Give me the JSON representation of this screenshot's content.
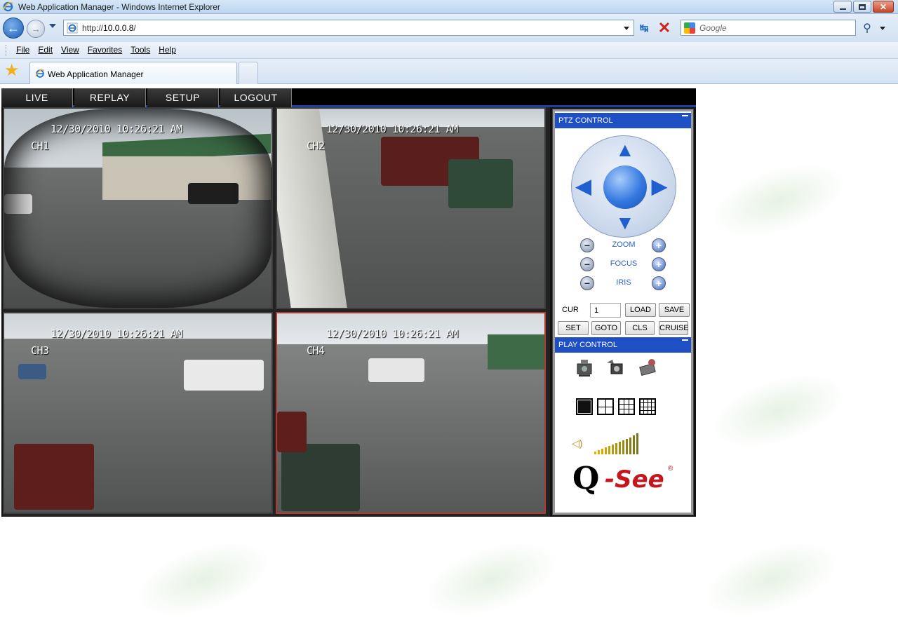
{
  "window": {
    "title": "Web Application Manager - Windows Internet Explorer"
  },
  "addressbar": {
    "url_prefix": "http://",
    "url_host": "10.0.0.8",
    "url_suffix": "/",
    "search_placeholder": "Google"
  },
  "menubar": {
    "items": [
      {
        "label": "File",
        "key": "F"
      },
      {
        "label": "Edit",
        "key": "E"
      },
      {
        "label": "View",
        "key": "V"
      },
      {
        "label": "Favorites",
        "key": "a"
      },
      {
        "label": "Tools",
        "key": "T"
      },
      {
        "label": "Help",
        "key": "H"
      }
    ]
  },
  "tabs": [
    {
      "label": "Web Application Manager"
    }
  ],
  "app": {
    "nav": [
      "LIVE",
      "REPLAY",
      "SETUP",
      "LOGOUT"
    ],
    "cameras": [
      {
        "timestamp": "12/30/2010 10:26:21 AM",
        "channel": "CH1"
      },
      {
        "timestamp": "12/30/2010 10:26:21 AM",
        "channel": "CH2"
      },
      {
        "timestamp": "12/30/2010 10:26:21 AM",
        "channel": "CH3"
      },
      {
        "timestamp": "12/30/2010 10:26:21 AM",
        "channel": "CH4"
      }
    ],
    "ptz": {
      "title": "PTZ CONTROL",
      "zoom": "ZOOM",
      "focus": "FOCUS",
      "iris": "IRIS",
      "cur_label": "CUR",
      "cur_value": "1",
      "load": "LOAD",
      "save": "SAVE",
      "set": "SET",
      "goto": "GOTO",
      "cls": "CLS",
      "cruise": "CRUISE"
    },
    "play": {
      "title": "PLAY CONTROL"
    },
    "logo": {
      "q": "Q",
      "see": "-See",
      "reg": "®"
    }
  }
}
